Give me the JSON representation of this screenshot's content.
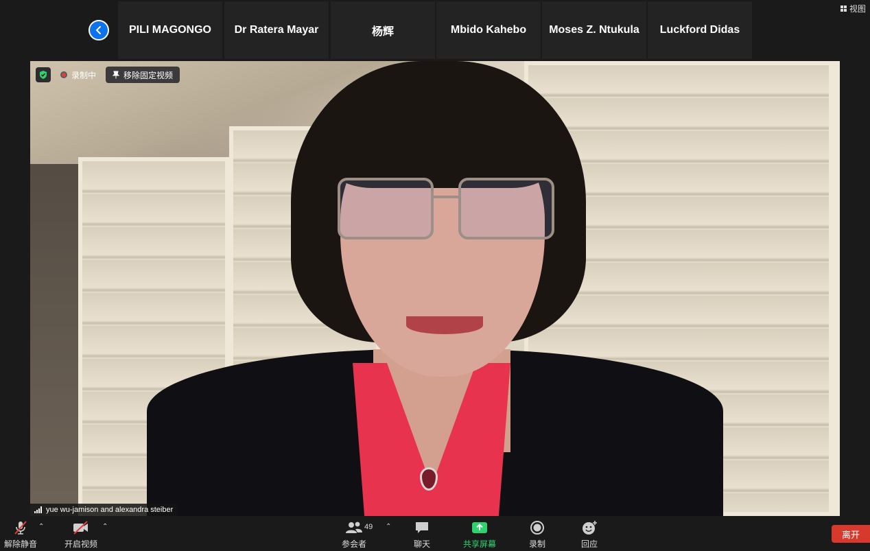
{
  "header": {
    "back_icon": "chevron-left-icon",
    "participants": [
      "PILI MAGONGO",
      "Dr Ratera Mayar",
      "杨辉",
      "Mbido Kahebo",
      "Moses Z. Ntukula",
      "Luckford Didas"
    ],
    "view_label": "视图"
  },
  "video": {
    "recording_label": "录制中",
    "unpin_label": "移除固定视频",
    "speaker_name": "yue wu-jamison and alexandra steiber"
  },
  "toolbar": {
    "unmute_label": "解除静音",
    "start_video_label": "开启视频",
    "participants_label": "参会者",
    "participants_count": "49",
    "chat_label": "聊天",
    "share_screen_label": "共享屏幕",
    "record_label": "录制",
    "reactions_label": "回应",
    "leave_label": "离开"
  },
  "colors": {
    "accent_blue": "#0e72ed",
    "share_green": "#2dd36f",
    "leave_red": "#d7392d",
    "record_red": "#e0413e"
  }
}
